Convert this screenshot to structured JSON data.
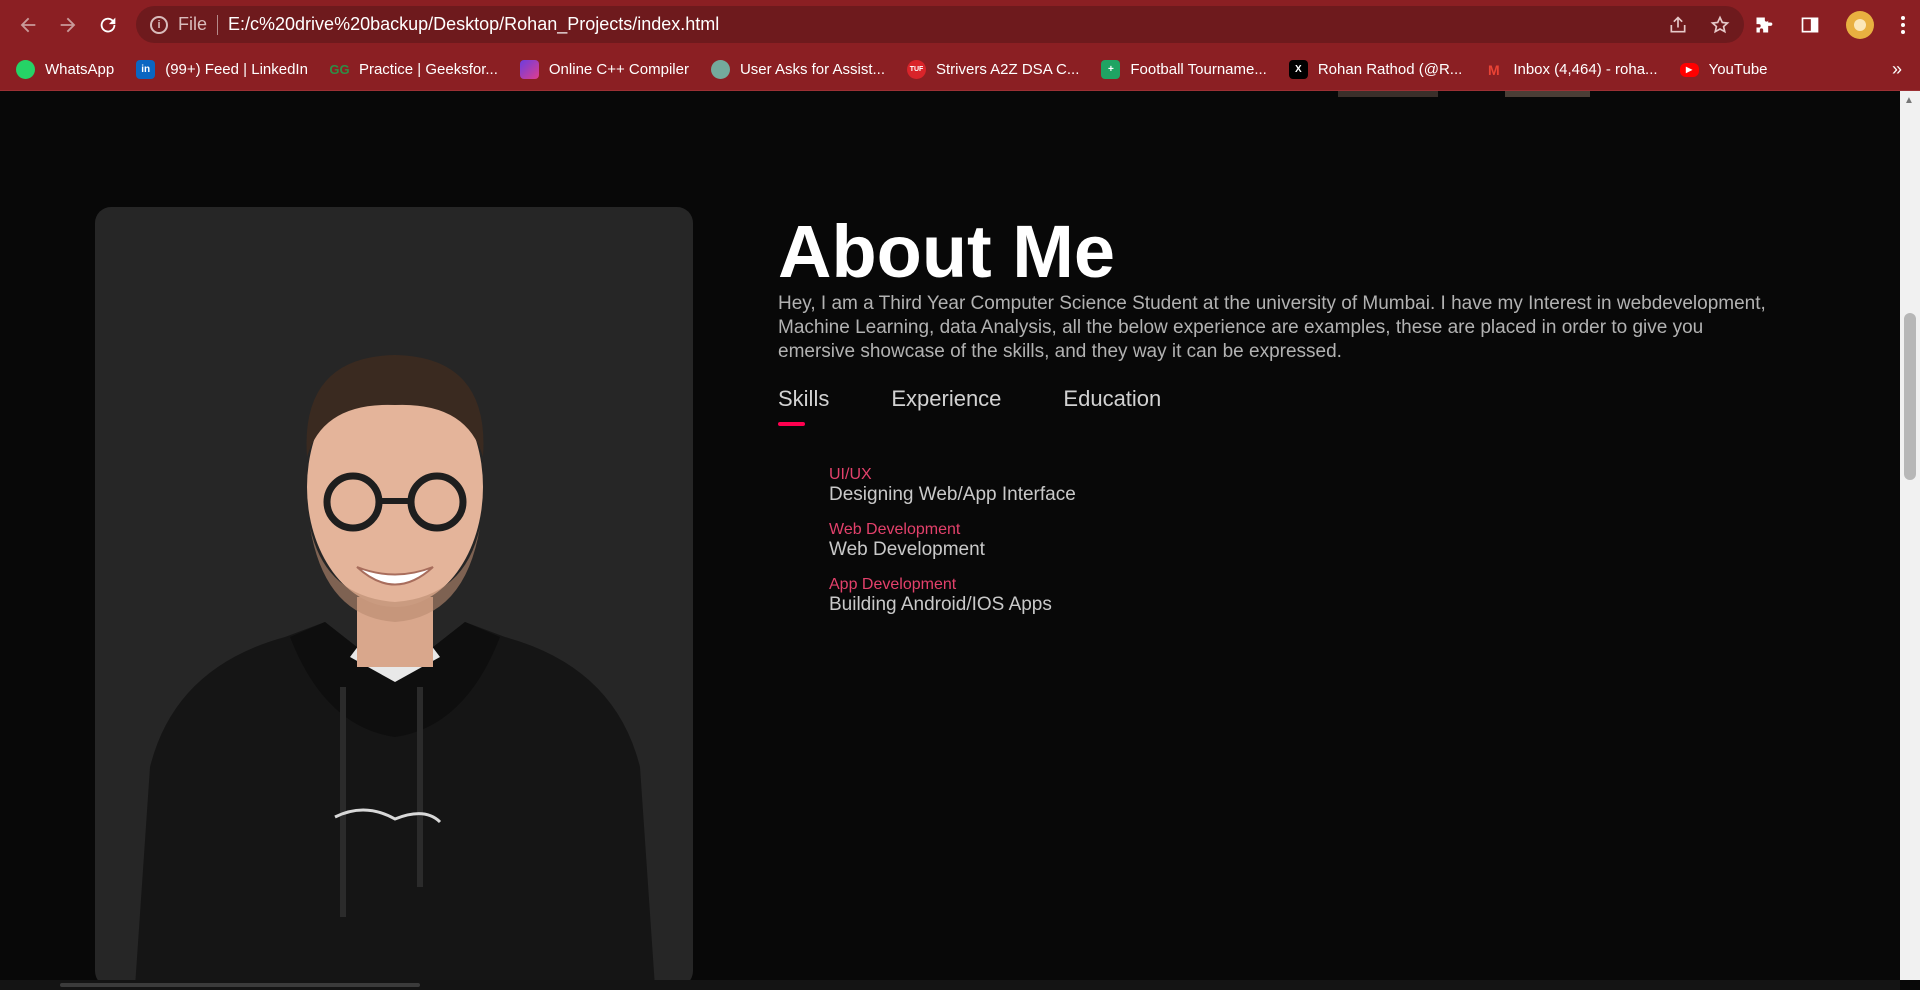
{
  "browser": {
    "scheme_label": "File",
    "url": "E:/c%20drive%20backup/Desktop/Rohan_Projects/index.html",
    "bookmarks": [
      {
        "label": "WhatsApp",
        "icon": "whatsapp-icon",
        "color": "#25d366"
      },
      {
        "label": "(99+) Feed | LinkedIn",
        "icon": "linkedin-icon",
        "color": "#0a66c2"
      },
      {
        "label": "Practice | Geeksfor...",
        "icon": "geeksforgeeks-icon",
        "color": "#2f8d46"
      },
      {
        "label": "Online C++ Compiler",
        "icon": "compiler-icon",
        "color": "#6b3de0"
      },
      {
        "label": "User Asks for Assist...",
        "icon": "chatgpt-icon",
        "color": "#74aa9c"
      },
      {
        "label": "Strivers A2Z DSA C...",
        "icon": "tuf-icon",
        "color": "#d9242a"
      },
      {
        "label": "Football Tourname...",
        "icon": "sheets-icon",
        "color": "#1fa463"
      },
      {
        "label": "Rohan Rathod (@R...",
        "icon": "x-icon",
        "color": "#000000"
      },
      {
        "label": "Inbox (4,464) - roha...",
        "icon": "gmail-icon",
        "color": "#ea4335"
      },
      {
        "label": "YouTube",
        "icon": "youtube-icon",
        "color": "#ff0000"
      }
    ],
    "more_label": "»"
  },
  "about": {
    "title": "About Me",
    "description": "Hey, I am a Third Year Computer Science Student at the university of Mumbai. I have my Interest in webdevelopment, Machine Learning, data Analysis, all the below experience are examples, these are placed in order to give you emersive showcase of the skills, and they way it can be expressed.",
    "tabs": [
      {
        "label": "Skills",
        "active": true
      },
      {
        "label": "Experience",
        "active": false
      },
      {
        "label": "Education",
        "active": false
      }
    ],
    "skills": [
      {
        "title": "UI/UX",
        "desc": "Designing Web/App Interface"
      },
      {
        "title": "Web Development",
        "desc": "Web Development"
      },
      {
        "title": "App Development",
        "desc": "Building Android/IOS Apps"
      }
    ]
  },
  "colors": {
    "chrome": "#8b1f23",
    "accent": "#ff004f",
    "skill_title": "#e3416b",
    "background": "#080808",
    "card": "#262626"
  }
}
